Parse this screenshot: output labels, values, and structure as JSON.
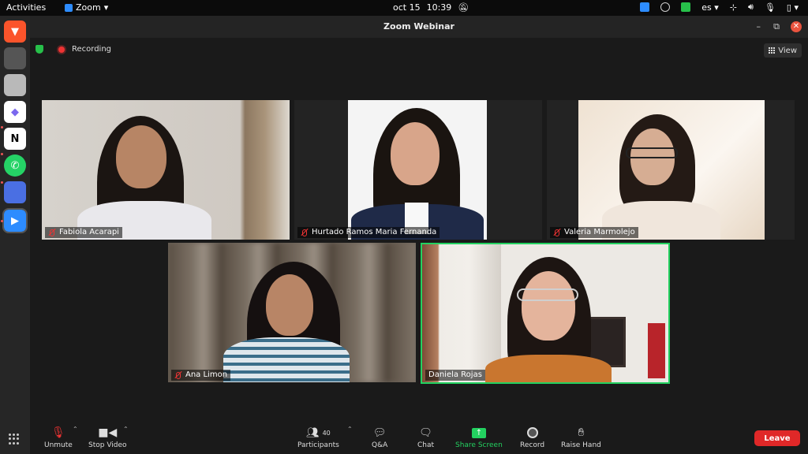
{
  "topbar": {
    "activities": "Activities",
    "app_name": "Zoom",
    "date": "oct 15",
    "time": "10:39",
    "language": "es"
  },
  "window": {
    "title": "Zoom Webinar"
  },
  "meeting": {
    "recording_label": "Recording",
    "view_label": "View"
  },
  "participants": [
    {
      "name": "Fabiola Acarapi",
      "muted": true
    },
    {
      "name": "Hurtado Ramos Maria Fernanda",
      "muted": true
    },
    {
      "name": "Valeria Marmolejo",
      "muted": true
    },
    {
      "name": "Ana Limon",
      "muted": true
    },
    {
      "name": "Daniela Rojas",
      "muted": false
    }
  ],
  "toolbar": {
    "unmute": "Unmute",
    "stop_video": "Stop Video",
    "participants": "Participants",
    "participants_count": "40",
    "qa": "Q&A",
    "chat": "Chat",
    "share_screen": "Share Screen",
    "record": "Record",
    "raise_hand": "Raise Hand",
    "leave": "Leave"
  },
  "colors": {
    "active_speaker": "#23d160",
    "leave": "#e02828",
    "muted": "#ee3333"
  }
}
